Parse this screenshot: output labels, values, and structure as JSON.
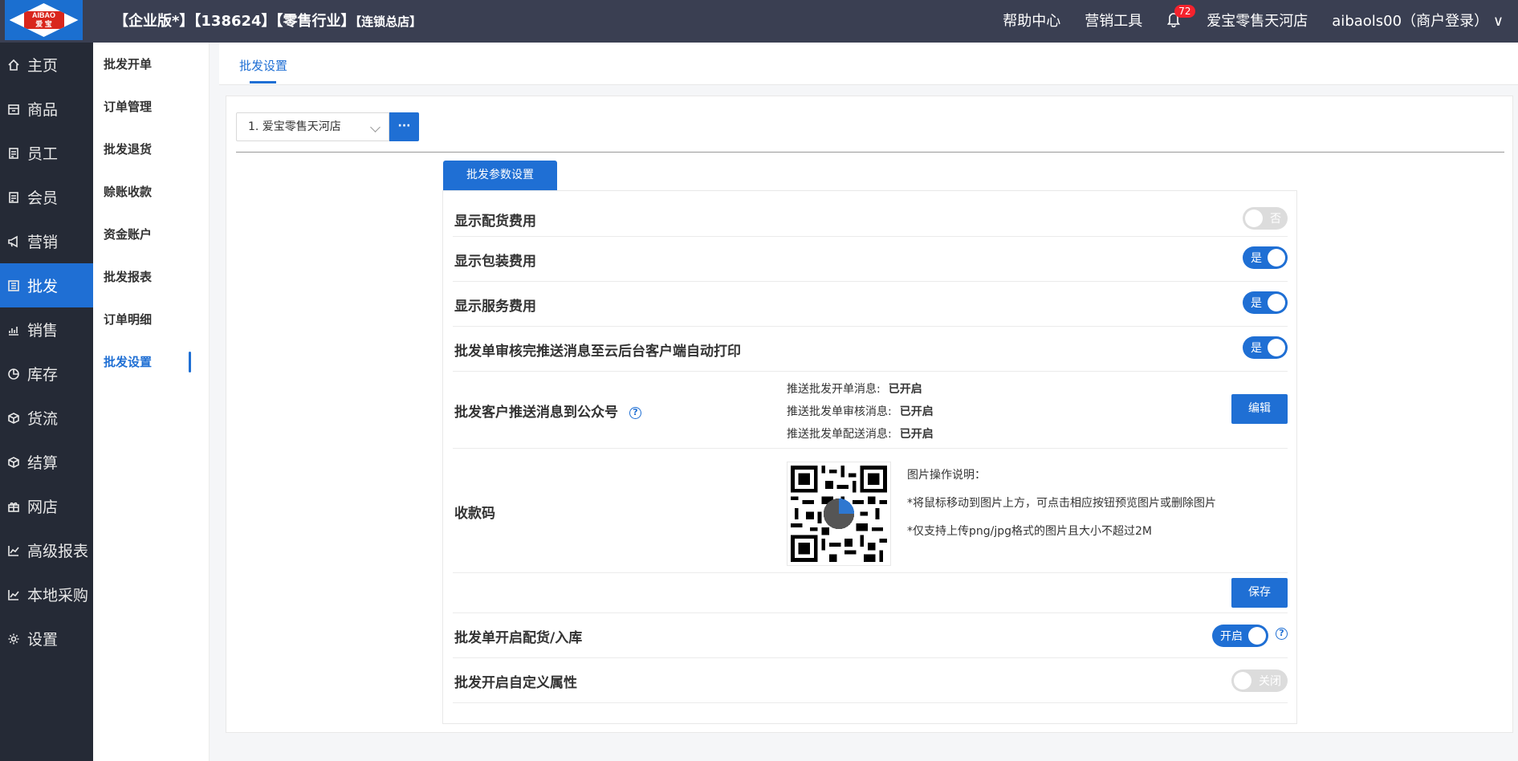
{
  "topbar": {
    "logo_top": "AIBAO",
    "logo_bottom": "爱 宝",
    "edition_main": "【企业版*】【138624】【零售行业】",
    "edition_store": "【连锁总店】",
    "help": "帮助中心",
    "marketing_tools": "营销工具",
    "notification_count": "72",
    "store_name": "爱宝零售天河店",
    "user": "aibaols00（商户登录）"
  },
  "leftnav": [
    {
      "label": "主页",
      "icon": "home-icon"
    },
    {
      "label": "商品",
      "icon": "product-icon"
    },
    {
      "label": "员工",
      "icon": "staff-icon"
    },
    {
      "label": "会员",
      "icon": "member-icon"
    },
    {
      "label": "营销",
      "icon": "megaphone-icon"
    },
    {
      "label": "批发",
      "icon": "wholesale-icon"
    },
    {
      "label": "销售",
      "icon": "sales-chart-icon"
    },
    {
      "label": "库存",
      "icon": "inventory-pie-icon"
    },
    {
      "label": "货流",
      "icon": "logistics-icon"
    },
    {
      "label": "结算",
      "icon": "settlement-icon"
    },
    {
      "label": "网店",
      "icon": "gift-shop-icon"
    },
    {
      "label": "高级报表",
      "icon": "report-line-icon"
    },
    {
      "label": "本地采购",
      "icon": "purchase-line-icon"
    },
    {
      "label": "设置",
      "icon": "gear-icon"
    }
  ],
  "subnav": [
    "批发开单",
    "订单管理",
    "批发退货",
    "赊账收款",
    "资金账户",
    "批发报表",
    "订单明细",
    "批发设置"
  ],
  "tab": "批发设置",
  "store_select": "1. 爱宝零售天河店",
  "more_button": "···",
  "section_title": "批发参数设置",
  "settings": {
    "show_delivery_fee": {
      "label": "显示配货费用",
      "state": "否"
    },
    "show_packing_fee": {
      "label": "显示包装费用",
      "state": "是"
    },
    "show_service_fee": {
      "label": "显示服务费用",
      "state": "是"
    },
    "auto_print": {
      "label": "批发单审核完推送消息至云后台客户端自动打印",
      "state": "是"
    },
    "push_official": {
      "label": "批发客户推送消息到公众号",
      "lines": [
        {
          "k": "推送批发开单消息:",
          "v": "已开启"
        },
        {
          "k": "推送批发单审核消息:",
          "v": "已开启"
        },
        {
          "k": "推送批发单配送消息:",
          "v": "已开启"
        }
      ],
      "edit_button": "编辑"
    },
    "payment_code": {
      "label": "收款码",
      "notes": [
        "图片操作说明：",
        "*将鼠标移动到图片上方，可点击相应按钮预览图片或删除图片",
        "*仅支持上传png/jpg格式的图片且大小不超过2M"
      ],
      "save_button": "保存"
    },
    "enable_distribution": {
      "label": "批发单开启配货/入库",
      "state": "开启"
    },
    "custom_attributes": {
      "label": "批发开启自定义属性",
      "state": "关闭"
    }
  },
  "colors": {
    "primary": "#1f6fd4",
    "nav_bg": "#252a36",
    "topbar_bg": "#3a3f52"
  }
}
